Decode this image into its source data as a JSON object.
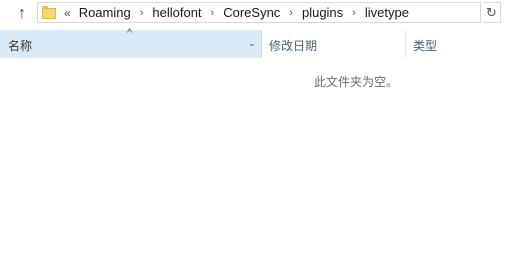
{
  "address": {
    "overflow": "«",
    "crumbs": [
      "Roaming",
      "hellofont",
      "CoreSync",
      "plugins",
      "livetype"
    ],
    "separator": "›"
  },
  "icons": {
    "up": "up-arrow-icon",
    "folder": "folder-icon",
    "refresh": "refresh-icon",
    "sort": "sort-ascending-icon",
    "dropdown": "chevron-down-icon"
  },
  "glyphs": {
    "up": "↑",
    "refresh": "↻",
    "sort": "^",
    "dropdown": "⌄"
  },
  "columns": {
    "name": "名称",
    "date_modified": "修改日期",
    "type": "类型"
  },
  "empty_message": "此文件夹为空。",
  "colors": {
    "selected_header_bg": "#d9ebf9",
    "header_text": "#4c607a"
  }
}
